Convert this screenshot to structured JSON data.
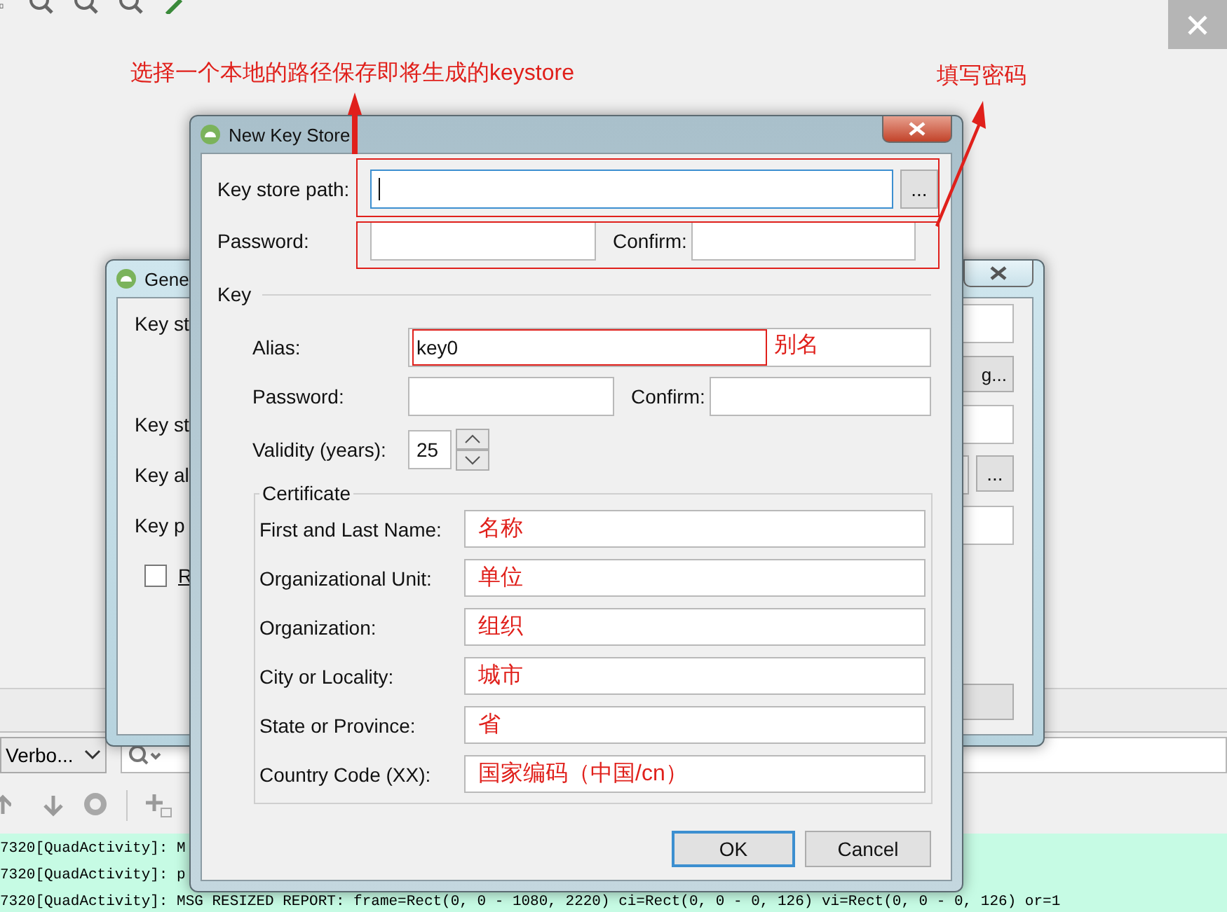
{
  "ide": {
    "log_level": "Verbo...",
    "log_lines": [
      "7320[QuadActivity]: M",
      "7320[QuadActivity]: p",
      "7320[QuadActivity]: MSG RESIZED REPORT: frame=Rect(0, 0 - 1080, 2220) ci=Rect(0, 0 - 0, 126) vi=Rect(0, 0 - 0, 126) or=1"
    ]
  },
  "annotations": {
    "path_note": "选择一个本地的路径保存即将生成的keystore",
    "password_note": "填写密码",
    "alias_note": "别名"
  },
  "back_dialog": {
    "title": "Gene",
    "labels": [
      "Key st",
      "Key st",
      "Key al",
      "Key p"
    ],
    "checkbox": {
      "label": "R",
      "checked": false
    },
    "choose_button": "g...",
    "browse_button": "..."
  },
  "dialog": {
    "title": "New Key Store",
    "key_store_path": {
      "label": "Key store path:",
      "focused": true
    },
    "browse_button": "...",
    "password": {
      "label": "Password:"
    },
    "confirm": {
      "label": "Confirm:"
    },
    "key_section": "Key",
    "alias": {
      "label": "Alias:",
      "value": "key0"
    },
    "key_password": {
      "label": "Password:"
    },
    "key_confirm": {
      "label": "Confirm:"
    },
    "validity": {
      "label": "Validity (years):",
      "value": "25"
    },
    "certificate": {
      "title": "Certificate",
      "fields": [
        {
          "label": "First and Last Name:",
          "value": "名称"
        },
        {
          "label": "Organizational Unit:",
          "value": "单位"
        },
        {
          "label": "Organization:",
          "value": "组织"
        },
        {
          "label": "City or Locality:",
          "value": "城市"
        },
        {
          "label": "State or Province:",
          "value": "省"
        },
        {
          "label": "Country Code (XX):",
          "value": "国家编码（中国/cn）"
        }
      ]
    },
    "buttons": [
      {
        "label": "OK",
        "default": true
      },
      {
        "label": "Cancel",
        "default": false
      }
    ]
  }
}
